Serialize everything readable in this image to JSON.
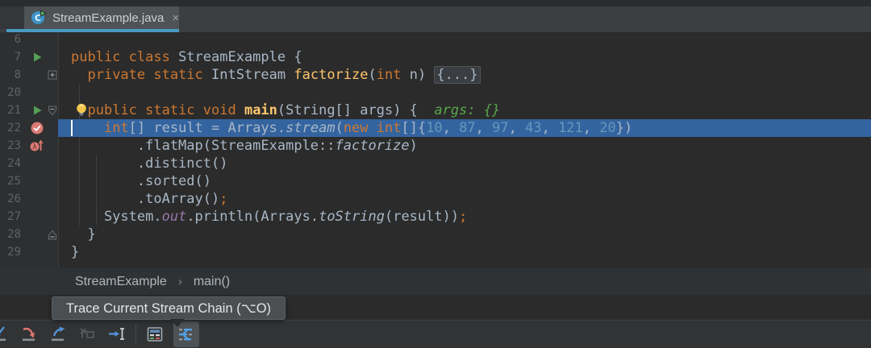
{
  "tab": {
    "title": "StreamExample.java",
    "close_glyph": "×",
    "icon": "java-class-run-icon"
  },
  "editor": {
    "lines": [
      {
        "num": "6",
        "segments": []
      },
      {
        "num": "7",
        "gutter_icon": "run-icon",
        "segments": [
          {
            "t": "public class ",
            "c": "kw"
          },
          {
            "t": "StreamExample {",
            "c": "d"
          }
        ]
      },
      {
        "num": "8",
        "fold": "collapsed",
        "segments": [
          {
            "t": "  ",
            "c": "d"
          },
          {
            "t": "private static ",
            "c": "kw"
          },
          {
            "t": "IntStream ",
            "c": "d"
          },
          {
            "t": "factorize",
            "c": "m"
          },
          {
            "t": "(",
            "c": "d"
          },
          {
            "t": "int",
            "c": "kw"
          },
          {
            "t": " n) ",
            "c": "d"
          },
          {
            "t": "{...}",
            "c": "fold"
          }
        ]
      },
      {
        "num": "20",
        "segments": []
      },
      {
        "num": "21",
        "gutter_icon": "run-icon",
        "fold": "open",
        "bulb": true,
        "segments": [
          {
            "t": "  ",
            "c": "d"
          },
          {
            "t": "public static void ",
            "c": "kw"
          },
          {
            "t": "main",
            "c": "mb"
          },
          {
            "t": "(String[] args) {",
            "c": "d"
          },
          {
            "t": "  ",
            "c": "d"
          },
          {
            "t": "args: {}",
            "c": "hint"
          }
        ]
      },
      {
        "num": "22",
        "gutter_icon": "verified-breakpoint-icon",
        "highlight": true,
        "caret": true,
        "segments": [
          {
            "t": "    ",
            "c": "d"
          },
          {
            "t": "int",
            "c": "kw"
          },
          {
            "t": "[] result = Arrays.",
            "c": "d"
          },
          {
            "t": "stream",
            "c": "it"
          },
          {
            "t": "(",
            "c": "d"
          },
          {
            "t": "new int",
            "c": "kw"
          },
          {
            "t": "[]{",
            "c": "d"
          },
          {
            "t": "10",
            "c": "num"
          },
          {
            "t": ", ",
            "c": "d"
          },
          {
            "t": "87",
            "c": "num"
          },
          {
            "t": ", ",
            "c": "d"
          },
          {
            "t": "97",
            "c": "num"
          },
          {
            "t": ", ",
            "c": "d"
          },
          {
            "t": "43",
            "c": "num"
          },
          {
            "t": ", ",
            "c": "d"
          },
          {
            "t": "121",
            "c": "num"
          },
          {
            "t": ", ",
            "c": "d"
          },
          {
            "t": "20",
            "c": "num"
          },
          {
            "t": "})",
            "c": "d"
          }
        ]
      },
      {
        "num": "23",
        "gutter_icon": "lambda-breakpoint-icon",
        "segments": [
          {
            "t": "        .flatMap(StreamExample::",
            "c": "d"
          },
          {
            "t": "factorize",
            "c": "it"
          },
          {
            "t": ")",
            "c": "d"
          }
        ]
      },
      {
        "num": "24",
        "segments": [
          {
            "t": "        .distinct()",
            "c": "d"
          }
        ]
      },
      {
        "num": "25",
        "segments": [
          {
            "t": "        .sorted()",
            "c": "d"
          }
        ]
      },
      {
        "num": "26",
        "segments": [
          {
            "t": "        .toArray()",
            "c": "d"
          },
          {
            "t": ";",
            "c": "kw"
          }
        ]
      },
      {
        "num": "27",
        "segments": [
          {
            "t": "    System.",
            "c": "d"
          },
          {
            "t": "out",
            "c": "sf"
          },
          {
            "t": ".println(Arrays.",
            "c": "d"
          },
          {
            "t": "toString",
            "c": "it"
          },
          {
            "t": "(result))",
            "c": "d"
          },
          {
            "t": ";",
            "c": "kw"
          }
        ]
      },
      {
        "num": "28",
        "fold": "end",
        "segments": [
          {
            "t": "  }",
            "c": "d"
          }
        ]
      },
      {
        "num": "29",
        "segments": [
          {
            "t": "}",
            "c": "d"
          }
        ]
      }
    ]
  },
  "breadcrumbs": {
    "items": [
      "StreamExample",
      "main()"
    ],
    "separator": "›"
  },
  "tooltip": {
    "text": "Trace Current Stream Chain (⌥O)"
  },
  "toolbar": {
    "items": [
      {
        "name": "step-into",
        "state": "cut"
      },
      {
        "name": "force-step-into"
      },
      {
        "name": "step-out"
      },
      {
        "name": "drop-frame",
        "state": "disabled"
      },
      {
        "name": "run-to-cursor"
      },
      {
        "name": "separator"
      },
      {
        "name": "evaluate-expression"
      },
      {
        "name": "trace-stream-chain",
        "state": "active"
      }
    ]
  },
  "colors": {
    "editor_bg": "#2B2B2B",
    "gutter_bg": "#2D2F30",
    "tabbar_bg": "#3C3F41",
    "tab_bg": "#4E5356",
    "tab_underline": "#4A9BC3",
    "execution_line": "#3464A0",
    "keyword": "#CC7832",
    "number": "#6897BB",
    "method": "#FFC66D",
    "default_text": "#A9B7C6",
    "static_field": "#9876AA",
    "debug_hint": "#57A64A",
    "line_number": "#606366",
    "breakpoint": "#DB7A74",
    "run_arrow": "#54A054",
    "tooltip_bg": "#4C4F51",
    "toolbar_bg": "#313335"
  }
}
